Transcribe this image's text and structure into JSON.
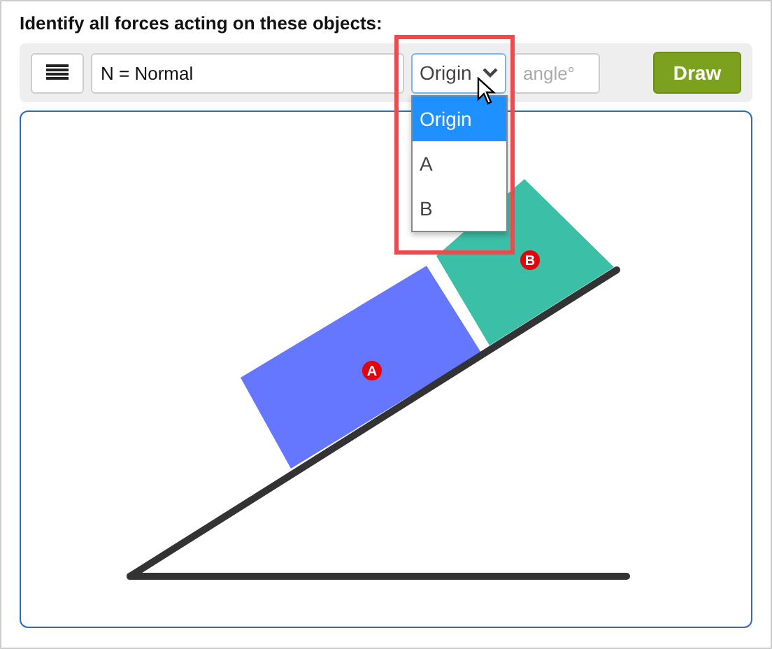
{
  "prompt": "Identify all forces acting on these objects:",
  "toolbar": {
    "force_field": {
      "value": "N = Normal"
    },
    "origin_select": {
      "value": "Origin",
      "expanded": true,
      "options": [
        {
          "label": "Origin",
          "selected": true
        },
        {
          "label": "A",
          "selected": false
        },
        {
          "label": "B",
          "selected": false
        }
      ]
    },
    "angle_field": {
      "placeholder": "angle°"
    },
    "draw_button": "Draw"
  },
  "canvas": {
    "objects": [
      {
        "label": "A",
        "color": "#6677ff"
      },
      {
        "label": "B",
        "color": "#3bbfa6"
      }
    ]
  },
  "highlight": true
}
